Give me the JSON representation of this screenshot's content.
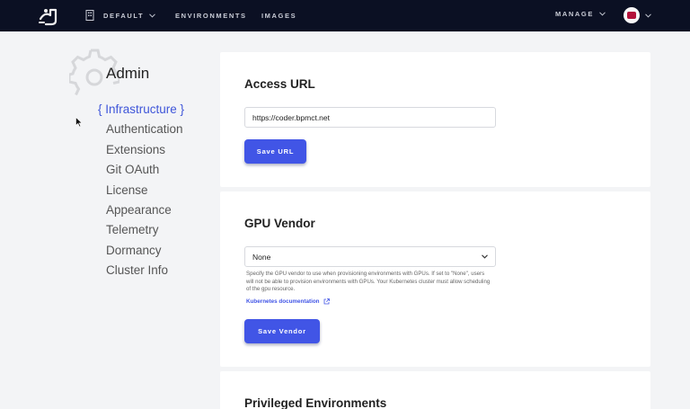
{
  "topbar": {
    "org_label": "DEFAULT",
    "environments_label": "ENVIRONMENTS",
    "images_label": "IMAGES",
    "manage_label": "MANAGE"
  },
  "sidebar": {
    "title": "Admin",
    "items": [
      {
        "label": "{ Infrastructure }",
        "active": true
      },
      {
        "label": "Authentication"
      },
      {
        "label": "Extensions"
      },
      {
        "label": "Git OAuth"
      },
      {
        "label": "License"
      },
      {
        "label": "Appearance"
      },
      {
        "label": "Telemetry"
      },
      {
        "label": "Dormancy"
      },
      {
        "label": "Cluster Info"
      }
    ]
  },
  "access_url": {
    "title": "Access URL",
    "value": "https://coder.bpmct.net",
    "save_label": "Save URL"
  },
  "gpu_vendor": {
    "title": "GPU Vendor",
    "selected": "None",
    "help_text": "Specify the GPU vendor to use when provisioning environments with GPUs. If set to \"None\", users will not be able to provision environments with GPUs. Your Kubernetes cluster must allow scheduling of the gpu resource.",
    "doc_link": "Kubernetes documentation",
    "save_label": "Save Vendor"
  },
  "privileged": {
    "title": "Privileged Environments"
  },
  "icons": [
    "logo-icon",
    "building-icon",
    "chevron-down-icon",
    "avatar",
    "gear-icon",
    "external-link-icon",
    "mouse-cursor-icon"
  ],
  "colors": {
    "topbar_bg": "#0b1023",
    "accent": "#4155e6",
    "active_nav": "#3f56d9",
    "page_bg": "#f3f4f6"
  }
}
